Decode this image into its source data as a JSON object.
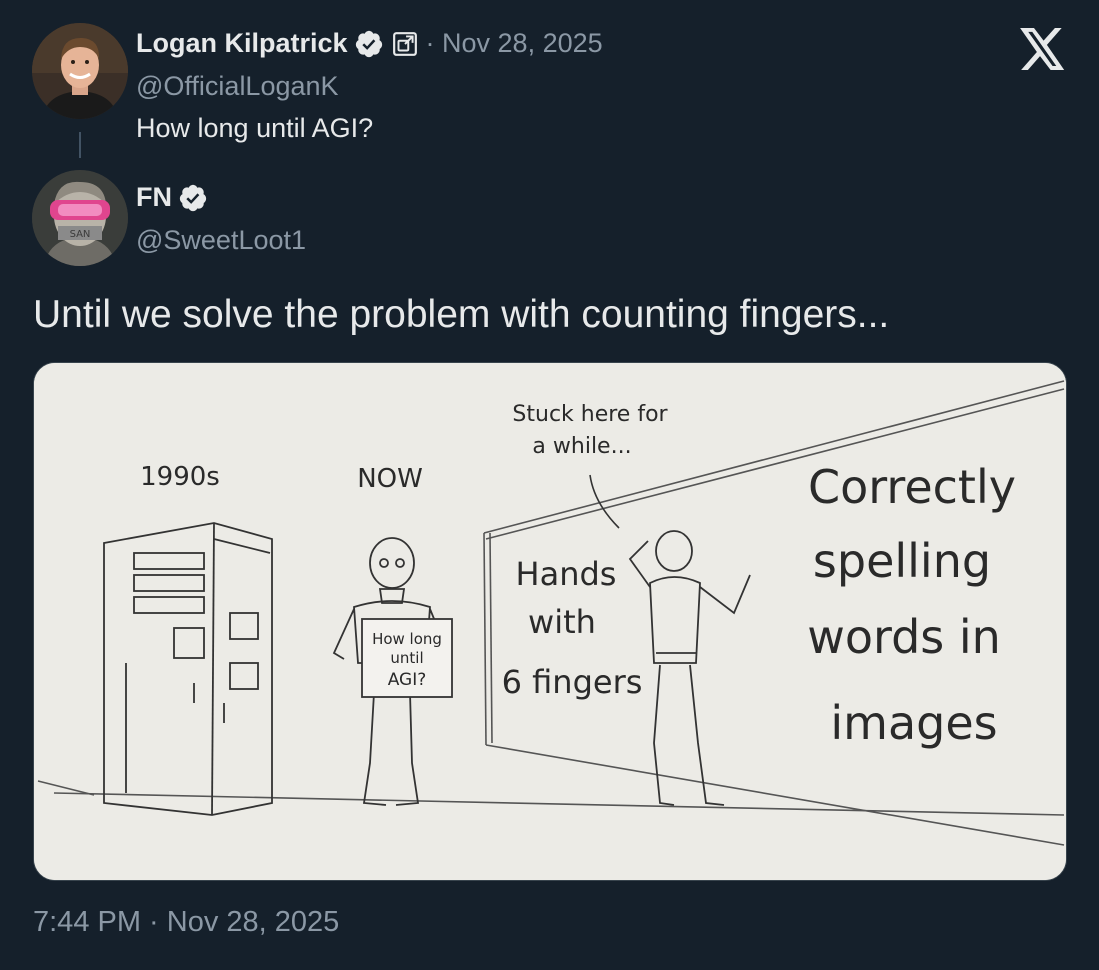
{
  "quoted_tweet": {
    "author_name": "Logan Kilpatrick",
    "handle": "@OfficialLoganK",
    "date": "· Nov 28, 2025",
    "text": "How long until AGI?"
  },
  "reply_tweet": {
    "author_name": "FN",
    "handle": "@SweetLoot1",
    "text": "Until we solve the problem with counting fingers...",
    "timestamp": "7:44 PM · Nov 28, 2025"
  },
  "image": {
    "label_1990s": "1990s",
    "label_now": "NOW",
    "sign_lines": [
      "How long",
      "until",
      "AGI?"
    ],
    "caption_lines": [
      "Stuck here for",
      "a while..."
    ],
    "wall_left_lines": [
      "Hands",
      "with",
      "6 fingers"
    ],
    "wall_right_lines": [
      "Correctly",
      "spelling",
      "words in",
      "images"
    ]
  },
  "icons": {
    "platform": "x-logo-icon",
    "verified": "verified-badge-icon",
    "affiliation": "affiliation-badge-icon"
  },
  "colors": {
    "background": "#15202b",
    "verified_badge": "#e7e9ea",
    "secondary_text": "#8b98a5",
    "image_paper": "#ecebe6"
  }
}
